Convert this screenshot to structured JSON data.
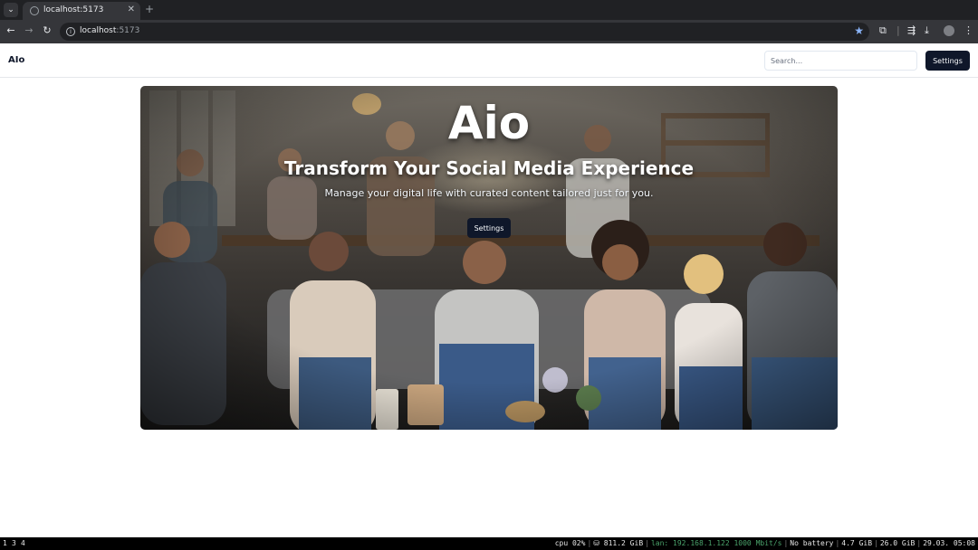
{
  "browser": {
    "tab_title": "localhost:5173",
    "tab_close": "✕",
    "new_tab": "+",
    "url_host": "localhost",
    "url_port": ":5173"
  },
  "header": {
    "brand": "AIo",
    "search_placeholder": "Search...",
    "settings_label": "Settings"
  },
  "hero": {
    "title": "Aio",
    "subtitle": "Transform Your Social Media Experience",
    "description": "Manage your digital life with curated content tailored just for you.",
    "button_label": "Settings"
  },
  "statusbar": {
    "workspaces": [
      "1",
      "3",
      "4"
    ],
    "cpu": "cpu  02%",
    "disk": "⛁ 811.2 GiB",
    "lan": "lan: 192.168.1.122 1000 Mbit/s",
    "battery": "No battery",
    "mem_used": "4.7 GiB",
    "mem_total": "26.0 GiB",
    "datetime": "29.03. 05:08"
  },
  "colors": {
    "primary_button": "#0f172a",
    "browser_frame": "#202124",
    "toolbar": "#35363a",
    "bookmark_star": "#8ab4f8"
  }
}
